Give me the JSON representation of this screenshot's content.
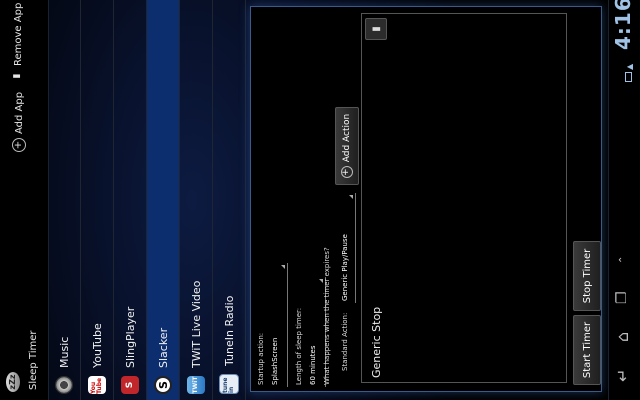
{
  "app": {
    "title": "Sleep Timer",
    "logo_text": "zZz"
  },
  "toolbar": {
    "add_app_label": "Add App",
    "remove_app_label": "Remove App"
  },
  "apps": [
    {
      "label": "Music",
      "icon": "music-icon",
      "selected": false
    },
    {
      "label": "YouTube",
      "icon": "youtube-icon",
      "icon_text": "You Tube",
      "selected": false
    },
    {
      "label": "SlingPlayer",
      "icon": "slingplayer-icon",
      "icon_text": "S",
      "selected": false
    },
    {
      "label": "Slacker",
      "icon": "slacker-icon",
      "icon_text": "S",
      "selected": true
    },
    {
      "label": "TWiT Live Video",
      "icon": "twit-icon",
      "icon_text": "TWiT",
      "selected": false
    },
    {
      "label": "TuneIn Radio",
      "icon": "tunein-icon",
      "icon_text": "tune in",
      "selected": false
    }
  ],
  "form": {
    "startup_action_label": "Startup action:",
    "startup_action_value": "SplashScreen",
    "length_label": "Length of sleep timer:",
    "length_value": "60 minutes",
    "question": "What happens when the timer expires?",
    "standard_action_label": "Standard Action:",
    "standard_action_value": "Generic Play/Pause",
    "add_action_label": "Add Action"
  },
  "actions_box": {
    "selected_action": "Generic Stop"
  },
  "buttons": {
    "start_label": "Start Timer",
    "stop_label": "Stop Timer"
  },
  "status": {
    "time": "4:16"
  },
  "colors": {
    "selected_row": "#0c2e6e",
    "panel_border": "#3a5a8a",
    "clock": "#9fc2e6"
  }
}
